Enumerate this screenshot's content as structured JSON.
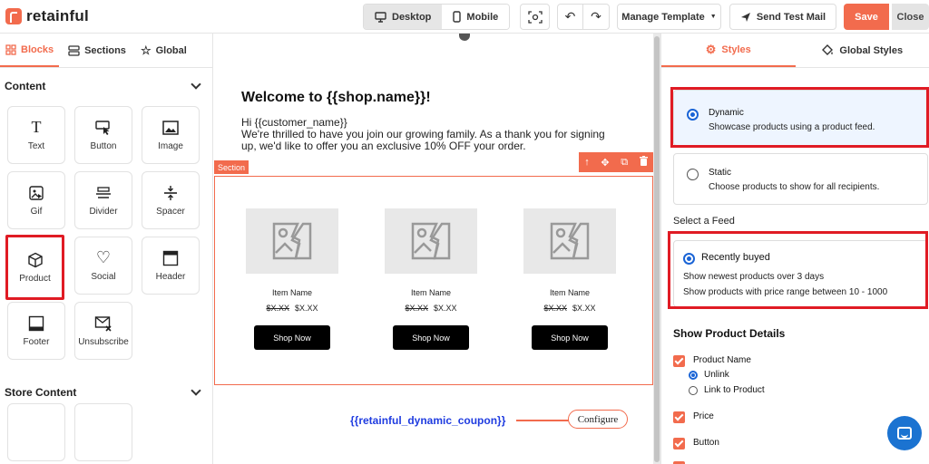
{
  "app": {
    "logo_text": "retainful"
  },
  "topbar": {
    "desktop_label": "Desktop",
    "mobile_label": "Mobile",
    "manage_template_label": "Manage Template",
    "send_test_label": "Send Test Mail",
    "save_label": "Save",
    "close_label": "Close"
  },
  "left_panel": {
    "tabs": [
      {
        "label": "Blocks",
        "icon": "blocks-icon"
      },
      {
        "label": "Sections",
        "icon": "sections-icon"
      },
      {
        "label": "Global",
        "icon": "star-icon"
      }
    ],
    "content_heading": "Content",
    "blocks": [
      {
        "label": "Text",
        "icon": "text-icon"
      },
      {
        "label": "Button",
        "icon": "button-icon"
      },
      {
        "label": "Image",
        "icon": "image-icon"
      },
      {
        "label": "Gif",
        "icon": "gif-icon"
      },
      {
        "label": "Divider",
        "icon": "divider-icon"
      },
      {
        "label": "Spacer",
        "icon": "spacer-icon"
      },
      {
        "label": "Product",
        "icon": "product-icon"
      },
      {
        "label": "Social",
        "icon": "heart-icon"
      },
      {
        "label": "Header",
        "icon": "header-icon"
      },
      {
        "label": "Footer",
        "icon": "footer-icon"
      },
      {
        "label": "Unsubscribe",
        "icon": "unsubscribe-icon"
      }
    ],
    "store_heading": "Store Content"
  },
  "canvas": {
    "title": "Welcome to {{shop.name}}!",
    "greeting": "Hi {{customer_name}}",
    "body": "We're thrilled to have you join our growing family. As a thank you for signing up, we'd like to offer you an exclusive 10% OFF your order.",
    "section_label": "Section",
    "products": [
      {
        "name": "Item Name",
        "old_price": "$X.XX",
        "price": "$X.XX",
        "button": "Shop Now"
      },
      {
        "name": "Item Name",
        "old_price": "$X.XX",
        "price": "$X.XX",
        "button": "Shop Now"
      },
      {
        "name": "Item Name",
        "old_price": "$X.XX",
        "price": "$X.XX",
        "button": "Shop Now"
      }
    ],
    "coupon_text": "{{retainful_dynamic_coupon}}",
    "configure_label": "Configure"
  },
  "right_panel": {
    "tabs": [
      {
        "label": "Styles",
        "icon": "gear-icon"
      },
      {
        "label": "Global Styles",
        "icon": "paint-bucket-icon"
      }
    ],
    "options": [
      {
        "title": "Dynamic",
        "desc": "Showcase products using a product feed.",
        "selected": true
      },
      {
        "title": "Static",
        "desc": "Choose products to show for all recipients.",
        "selected": false
      }
    ],
    "feed_label": "Select a Feed",
    "feed": {
      "title": "Recently buyed",
      "line1": "Show newest products over 3 days",
      "line2": "Show products with price range between 10 - 1000"
    },
    "details_title": "Show Product Details",
    "details": {
      "product_name": "Product Name",
      "unlink": "Unlink",
      "link": "Link to Product",
      "price": "Price",
      "button": "Button"
    }
  },
  "colors": {
    "accent": "#f26b4d",
    "highlight": "#e01b24",
    "radio": "#1a64d6",
    "coupon": "#1f3ce0"
  }
}
